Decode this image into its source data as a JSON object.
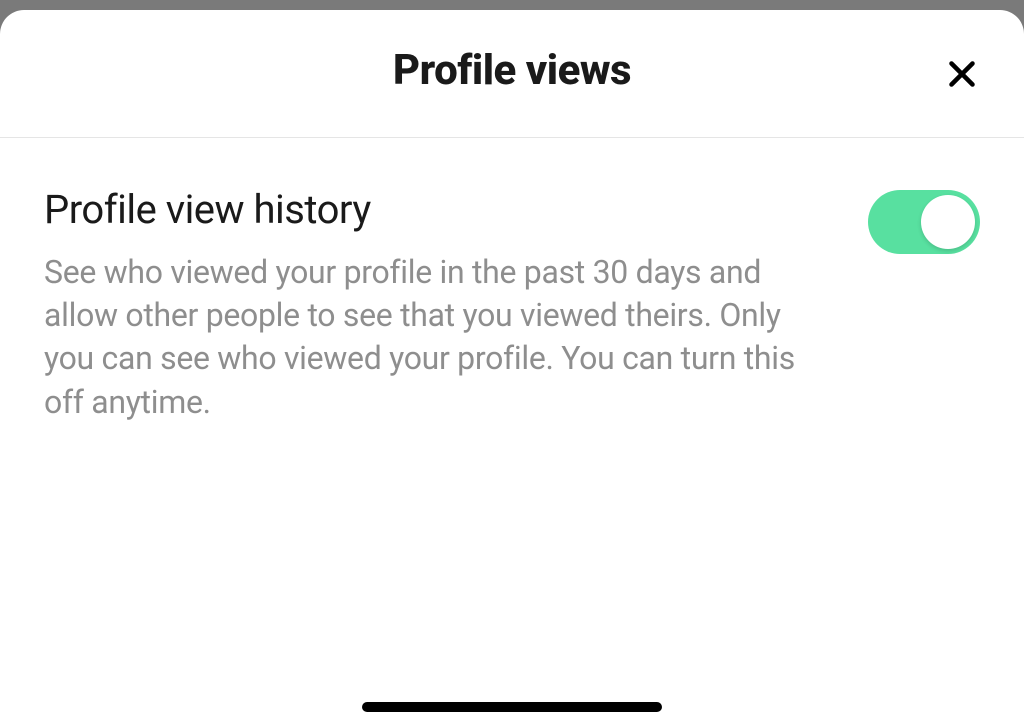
{
  "header": {
    "title": "Profile views"
  },
  "settings": {
    "profile_view_history": {
      "title": "Profile view history",
      "description": "See who viewed your profile in the past 30 days and allow other people to see that you viewed theirs. Only you can see who viewed your profile. You can turn this off anytime.",
      "enabled": true
    }
  },
  "colors": {
    "toggle_on": "#58e0a0"
  }
}
